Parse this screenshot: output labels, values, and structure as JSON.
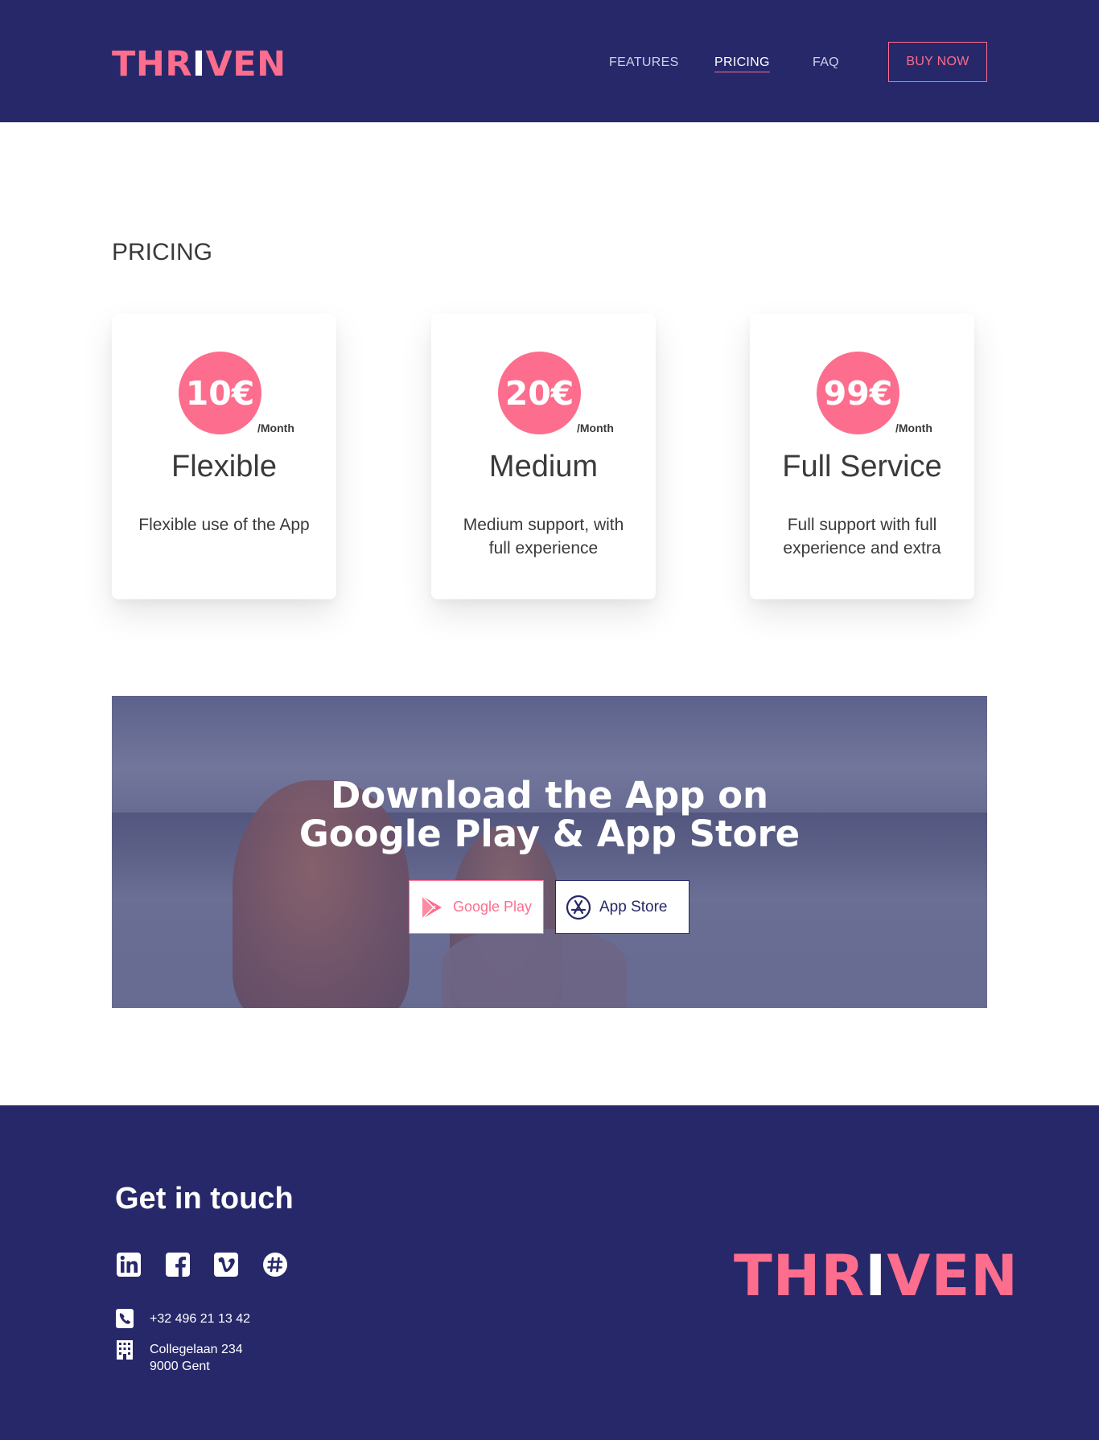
{
  "header": {
    "logo": {
      "part1": "THR",
      "part2": "I",
      "part3": "VEN"
    },
    "nav": {
      "features": "FEATURES",
      "pricing": "PRICING",
      "faq": "FAQ"
    },
    "buy_label": "BUY NOW"
  },
  "pricing": {
    "title": "PRICING",
    "plans": [
      {
        "price": "10€",
        "period": "/Month",
        "name": "Flexible",
        "desc": "Flexible use of the App"
      },
      {
        "price": "20€",
        "period": "/Month",
        "name": "Medium",
        "desc": "Medium support, with full experience"
      },
      {
        "price": "99€",
        "period": "/Month",
        "name": "Full Service",
        "desc": "Full support with full experience and extra"
      }
    ]
  },
  "download": {
    "title_line1": "Download the App on",
    "title_line2": "Google Play & App Store",
    "google_label": "Google Play",
    "apple_label": "App Store"
  },
  "footer": {
    "title": "Get in touch",
    "social_icons": [
      "linkedin-icon",
      "facebook-icon",
      "vimeo-icon",
      "slack-icon"
    ],
    "phone": "+32 496 21 13 42",
    "address_line1": "Collegelaan 234",
    "address_line2": "9000 Gent",
    "logo": {
      "part1": "THR",
      "part2": "I",
      "part3": "VEN"
    }
  },
  "colors": {
    "navy": "#27286a",
    "pink": "#fd6d8d",
    "text": "#3a3a3a"
  }
}
